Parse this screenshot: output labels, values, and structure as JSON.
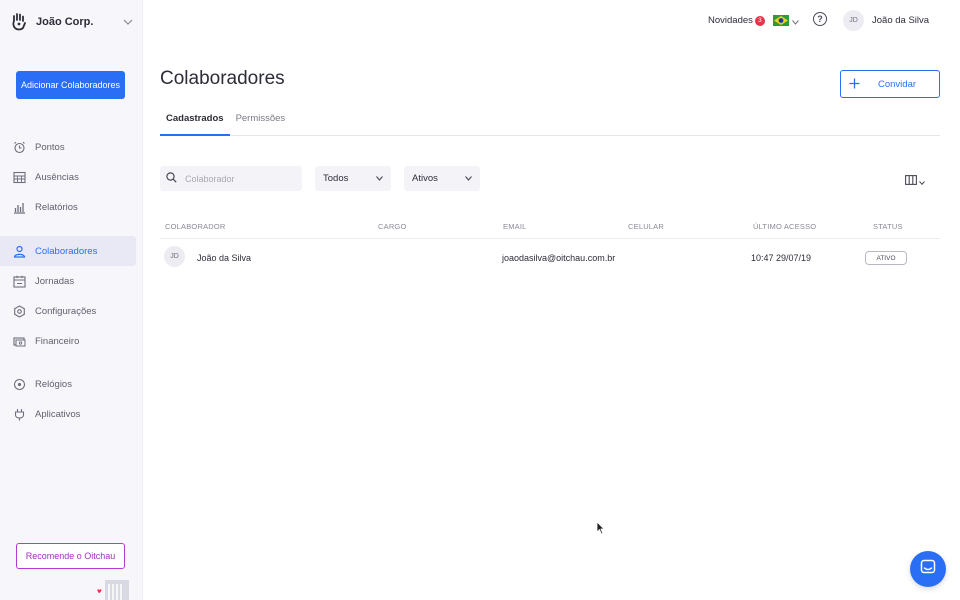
{
  "sidebar": {
    "company_name": "João Corp.",
    "add_button": "Adicionar Colaboradores",
    "nav_group1": [
      {
        "label": "Pontos",
        "icon": "alarm-clock-icon"
      },
      {
        "label": "Ausências",
        "icon": "calendar-grid-icon"
      },
      {
        "label": "Relatórios",
        "icon": "report-chart-icon"
      }
    ],
    "nav_group2": [
      {
        "label": "Colaboradores",
        "icon": "people-icon",
        "active": true
      },
      {
        "label": "Jornadas",
        "icon": "calendar-icon"
      },
      {
        "label": "Configurações",
        "icon": "gear-icon"
      },
      {
        "label": "Financeiro",
        "icon": "money-icon"
      }
    ],
    "nav_group3": [
      {
        "label": "Relógios",
        "icon": "clock-device-icon"
      },
      {
        "label": "Aplicativos",
        "icon": "plug-icon"
      }
    ],
    "recommend_button": "Recomende o Oitchau"
  },
  "topbar": {
    "news_label": "Novidades",
    "news_count": "3",
    "user_initials": "JD",
    "user_name": "João da Silva"
  },
  "main": {
    "title": "Colaboradores",
    "invite_button": "Convidar",
    "tabs": [
      "Cadastrados",
      "Permissões"
    ],
    "search_placeholder": "Colaborador",
    "filter1": "Todos",
    "filter2": "Ativos",
    "columns": [
      "COLABORADOR",
      "CARGO",
      "EMAIL",
      "CELULAR",
      "ÚLTIMO ACESSO",
      "STATUS"
    ],
    "rows": [
      {
        "initials": "JD",
        "name": "João da Silva",
        "cargo": "",
        "email": "joaodasilva@oitchau.com.br",
        "celular": "",
        "last_access": "10:47 29/07/19",
        "status": "ATIVO"
      }
    ]
  },
  "colors": {
    "accent": "#2a6ef6",
    "recommend": "#b23bd4",
    "badge": "#e8324a"
  }
}
